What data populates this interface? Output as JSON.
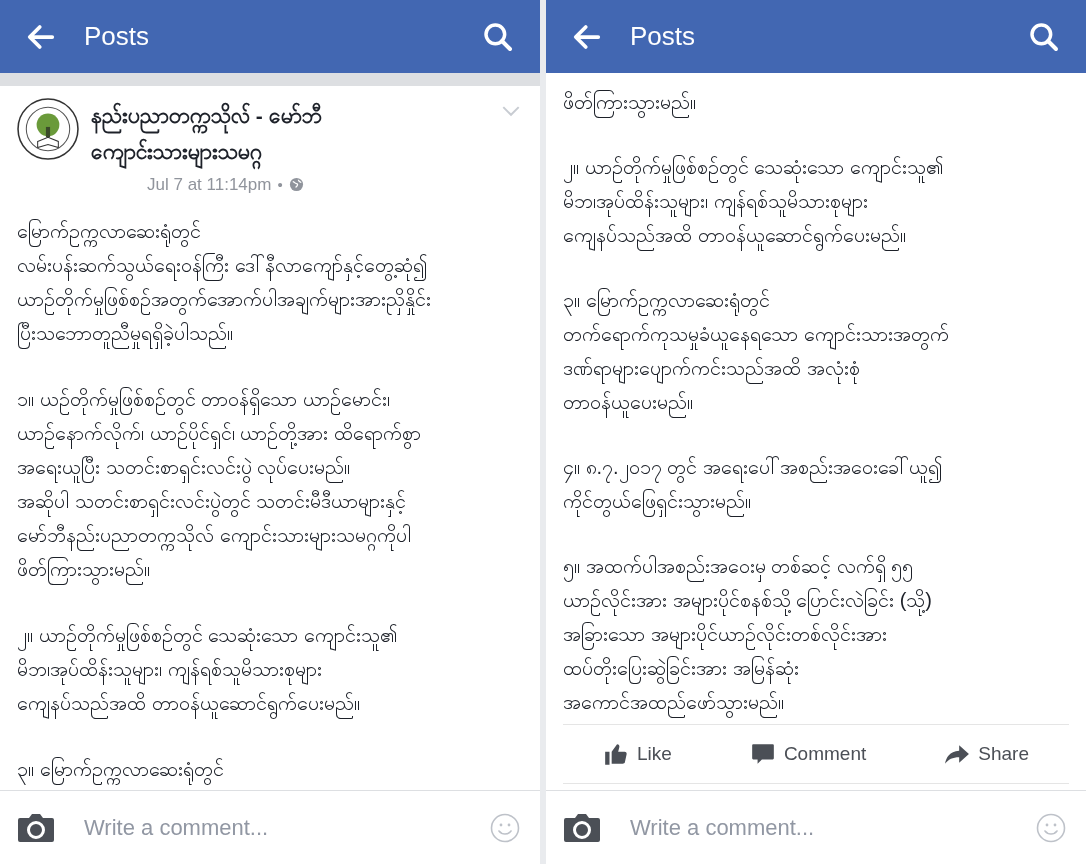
{
  "panels": [
    {
      "header": {
        "title": "Posts"
      },
      "post": {
        "author": "နည်းပညာတက္ကသိုလ် - မော်ဘီ ကျောင်းသားများသမဂ္ဂ",
        "time": "Jul 7 at 11:14pm",
        "dot": "•"
      },
      "paragraphs": [
        [
          "မြောက်ဥက္ကလာဆေးရုံတွင်",
          "လမ်းပန်းဆက်သွယ်ရေးဝန်ကြီး ဒေါ်နီလာကျော်နှင့်တွေ့ဆုံ၍",
          "ယာဉ်တိုက်မှုဖြစ်စဉ်အတွက်အောက်ပါအချက်များအားညှိနှိုင်း",
          "ပြီးသဘောတူညီမှုရရှိခဲ့ပါသည်။"
        ],
        [
          "၁။ ယဉ်တိုက်မှုဖြစ်စဉ်တွင် တာဝန်ရှိသော ယာဉ်မောင်း၊",
          "ယာဉ်နောက်လိုက်၊ ယာဉ်ပိုင်ရှင်၊ ယာဉ်တို့အား ထိရောက်စွာ",
          "အရေးယူပြီး သတင်းစာရှင်းလင်းပွဲ လုပ်ပေးမည်။",
          "အဆိုပါ သတင်းစာရှင်းလင်းပွဲတွင် သတင်းမီဒီယာများနှင့်",
          "မော်ဘီနည်းပညာတက္ကသိုလ် ကျောင်းသားများသမဂ္ဂကိုပါ",
          "ဖိတ်ကြားသွားမည်။"
        ],
        [
          "၂။ ယာဉ်တိုက်မှုဖြစ်စဉ်တွင် သေဆုံးသော ကျောင်းသူ၏",
          "မိဘ၊အုပ်ထိန်းသူများ၊ ကျန်ရစ်သူမိသားစုများ",
          "ကျေနပ်သည်အထိ တာဝန်ယူဆောင်ရွက်ပေးမည်။"
        ],
        [
          "၃။ မြောက်ဥက္ကလာဆေးရုံတွင်"
        ]
      ],
      "comment_bar": {
        "placeholder": "Write a comment..."
      }
    },
    {
      "header": {
        "title": "Posts"
      },
      "paragraphs": [
        [
          "ဖိတ်ကြားသွားမည်။"
        ],
        [
          "၂။ ယာဉ်တိုက်မှုဖြစ်စဉ်တွင် သေဆုံးသော ကျောင်းသူ၏",
          "မိဘ၊အုပ်ထိန်းသူများ၊ ကျန်ရစ်သူမိသားစုများ",
          "ကျေနပ်သည်အထိ တာဝန်ယူဆောင်ရွက်ပေးမည်။"
        ],
        [
          "၃။ မြောက်ဥက္ကလာဆေးရုံတွင်",
          "တက်ရောက်ကုသမှုခံယူနေရသော ကျောင်းသားအတွက်",
          "ဒဏ်ရာများပျောက်ကင်းသည်အထိ အလုံးစုံ",
          "တာဝန်ယူပေးမည်။"
        ],
        [
          "၄။ ၈.၇.၂၀၁၇ တွင် အရေးပေါ်အစည်းအဝေးခေါ်ယူ၍",
          "ကိုင်တွယ်ဖြေရှင်းသွားမည်။"
        ],
        [
          "၅။ အထက်ပါအစည်းအဝေးမှ တစ်ဆင့် လက်ရှိ ၅၅",
          "ယာဉ်လိုင်းအား အများပိုင်စနစ်သို့ ပြောင်းလဲခြင်း (သို့)",
          "အခြားသော အများပိုင်ယာဉ်လိုင်းတစ်လိုင်းအား",
          "ထပ်တိုးပြေးဆွဲခြင်းအား အမြန်ဆုံး",
          "အကောင်အထည်ဖော်သွားမည်။"
        ]
      ],
      "actions": [
        {
          "kind": "like",
          "label": "Like"
        },
        {
          "kind": "comment",
          "label": "Comment"
        },
        {
          "kind": "share",
          "label": "Share"
        }
      ],
      "comment_bar": {
        "placeholder": "Write a comment..."
      }
    }
  ]
}
